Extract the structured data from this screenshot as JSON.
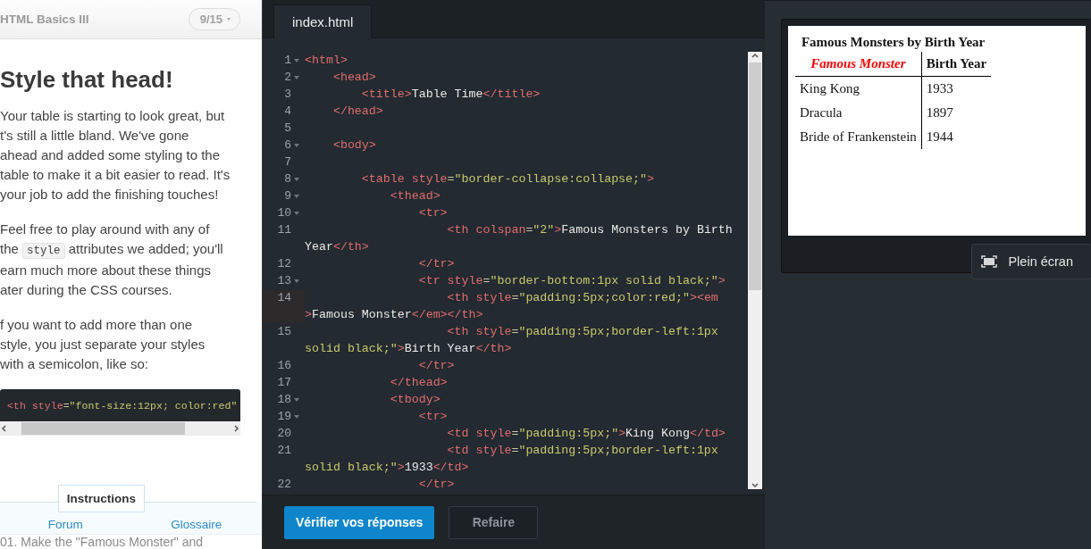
{
  "lesson": {
    "course": "HTML Basics III",
    "progress": "9/15",
    "title": "Style that head!",
    "paragraphs": [
      [
        [
          {
            "text": "Your table is starting to look great, but"
          }
        ],
        [
          {
            "text": "t's still a little bland. We've gone"
          }
        ],
        [
          {
            "text": "ahead and added some styling to the"
          }
        ],
        [
          {
            "text": "table to make it a bit easier to read. It's"
          }
        ],
        [
          {
            "text": "your job to add the finishing touches!"
          }
        ]
      ],
      [
        [
          {
            "text": "Feel free to play around with any of"
          }
        ],
        [
          {
            "text": "the "
          },
          {
            "text": "style",
            "code": true
          },
          {
            "text": " attributes we added; you'll"
          }
        ],
        [
          {
            "text": "earn much more about these things"
          }
        ],
        [
          {
            "text": "ater during the CSS courses."
          }
        ]
      ],
      [
        [
          {
            "text": "f you want to add more than one"
          }
        ],
        [
          {
            "text": "style, you just separate your styles"
          }
        ],
        [
          {
            "text": "with a semicolon, like so:"
          }
        ]
      ]
    ],
    "example": "<th style=\"font-size:12px; color:red\"",
    "tabs": [
      {
        "label": "Instructions",
        "selected": true
      }
    ],
    "links": [
      "Forum",
      "Glossaire"
    ],
    "hidden_step": "01. Make the \"Famous Monster\" and"
  },
  "editor": {
    "file_tab": {
      "label": "index.html",
      "selected": true
    },
    "lines": [
      {
        "number": "1",
        "fold": true,
        "active": false,
        "rows": [
          "<html>"
        ]
      },
      {
        "number": "2",
        "fold": true,
        "active": false,
        "rows": [
          "    <head>"
        ]
      },
      {
        "number": "3",
        "fold": false,
        "active": false,
        "rows": [
          "        <title>Table Time</title>"
        ]
      },
      {
        "number": "4",
        "fold": false,
        "active": false,
        "rows": [
          "    </head>"
        ]
      },
      {
        "number": "5",
        "fold": false,
        "active": false
      },
      {
        "number": "6",
        "fold": true,
        "active": false,
        "rows": [
          "    <body>"
        ]
      },
      {
        "number": "7",
        "fold": false,
        "active": false
      },
      {
        "number": "8",
        "fold": true,
        "active": false,
        "rows": [
          "        <table style=\"border-collapse:collapse;\">"
        ]
      },
      {
        "number": "9",
        "fold": true,
        "active": false,
        "rows": [
          "            <thead>"
        ]
      },
      {
        "number": "10",
        "fold": true,
        "active": false,
        "rows": [
          "                <tr>"
        ]
      },
      {
        "number": "11",
        "fold": false,
        "active": false,
        "rows": [
          "                    <th colspan=\"2\">Famous Monsters by Birth",
          "Year</th>"
        ]
      },
      {
        "number": "12",
        "fold": false,
        "active": false,
        "rows": [
          "                </tr>"
        ]
      },
      {
        "number": "13",
        "fold": true,
        "active": false,
        "rows": [
          "                <tr style=\"border-bottom:1px solid black;\">"
        ]
      },
      {
        "number": "14",
        "fold": false,
        "active": true,
        "rows": [
          "                    <th style=\"padding:5px;color:red;\"><em",
          ">Famous Monster</em></th>"
        ]
      },
      {
        "number": "15",
        "fold": false,
        "active": false,
        "rows": [
          "                    <th style=\"padding:5px;border-left:1px",
          "solid black;\">Birth Year</th>"
        ]
      },
      {
        "number": "16",
        "fold": false,
        "active": false,
        "rows": [
          "                </tr>"
        ]
      },
      {
        "number": "17",
        "fold": false,
        "active": false,
        "rows": [
          "            </thead>"
        ]
      },
      {
        "number": "18",
        "fold": true,
        "active": false,
        "rows": [
          "            <tbody>"
        ]
      },
      {
        "number": "19",
        "fold": true,
        "active": false,
        "rows": [
          "                <tr>"
        ]
      },
      {
        "number": "20",
        "fold": false,
        "active": false,
        "rows": [
          "                    <td style=\"padding:5px;\">King Kong</td>"
        ]
      },
      {
        "number": "21",
        "fold": false,
        "active": false,
        "rows": [
          "                    <td style=\"padding:5px;border-left:1px",
          "solid black;\">1933</td>"
        ]
      },
      {
        "number": "22",
        "fold": false,
        "active": false,
        "rows": [
          "                </tr>"
        ]
      }
    ],
    "buttons": [
      {
        "label": "Vérifier vos réponses",
        "kind": "primary"
      },
      {
        "label": "Refaire",
        "kind": "secondary"
      }
    ]
  },
  "preview": {
    "table": {
      "caption": "Famous Monsters by Birth Year",
      "columns": [
        {
          "label": "Famous Monster",
          "emphasis": true
        },
        {
          "label": "Birth Year",
          "emphasis": false
        }
      ],
      "rows": [
        [
          "King Kong",
          "1933"
        ],
        [
          "Dracula",
          "1897"
        ],
        [
          "Bride of Frankenstein",
          "1944"
        ]
      ]
    },
    "fullscreen_button": "Plein écran"
  }
}
